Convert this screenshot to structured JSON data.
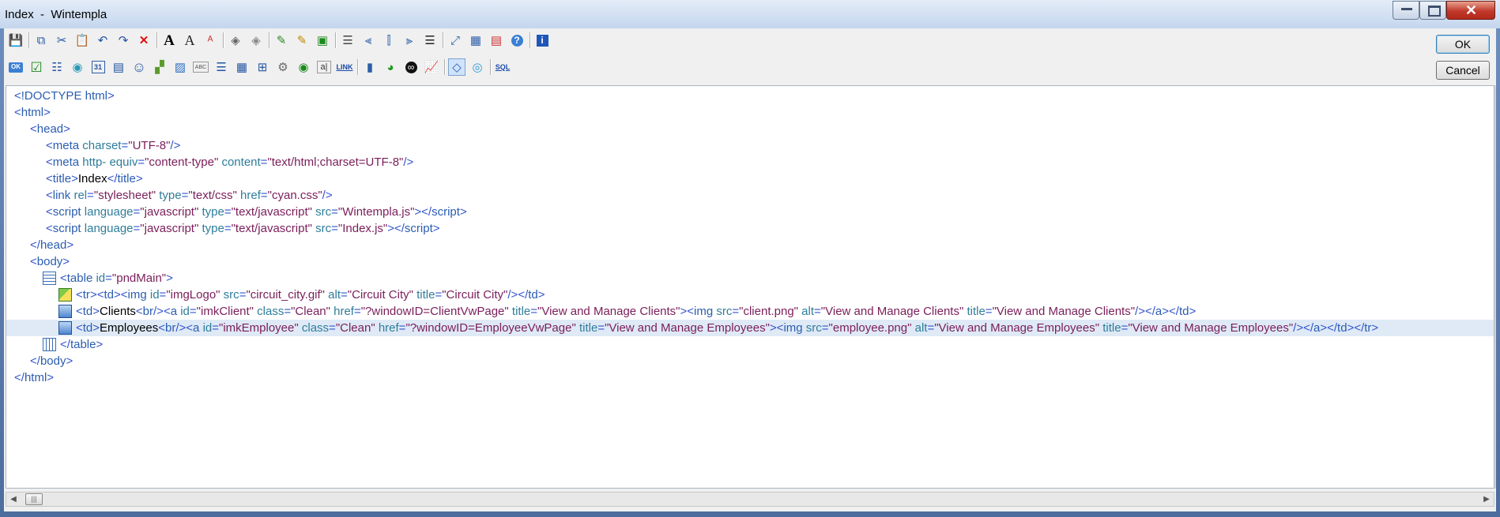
{
  "window": {
    "title": "Index  -  Wintempla",
    "minimize_label": "",
    "maximize_label": "",
    "close_label": "✕"
  },
  "dialog_buttons": {
    "ok": "OK",
    "cancel": "Cancel"
  },
  "toolbar1": {
    "icons": [
      "save-icon",
      "copy-icon",
      "cut-icon",
      "paste-icon",
      "undo-icon",
      "redo-icon",
      "delete-icon",
      "font-icon",
      "font-color-icon",
      "auto-font-icon",
      "fill-icon",
      "auto-fill-icon",
      "pencils-icon",
      "auto-pencils-icon",
      "frame-icon",
      "auto-lines-icon",
      "align-left-icon",
      "align-center-icon",
      "align-right-icon",
      "justify-icon",
      "fit-icon",
      "table-icon",
      "grid-icon",
      "help-icon",
      "info-icon"
    ]
  },
  "toolbar2": {
    "icons": [
      "ok-button-icon",
      "checkbox-icon",
      "listbox-icon",
      "radio-icon",
      "date-icon",
      "dropdown-icon",
      "smiley-icon",
      "chart-image-icon",
      "picture-icon",
      "abc-textbox-icon",
      "listview-icon",
      "grid-view-icon",
      "tree-view-icon",
      "tool-icon",
      "radio-button-icon",
      "label-icon",
      "link-icon",
      "bar-chart-icon",
      "pie-chart-icon",
      "sensor-icon",
      "line-chart-icon",
      "code-view-icon",
      "web-icon",
      "sql-icon"
    ],
    "link_text": "LINK",
    "sql_text": "SQL",
    "abc_text": "ABC"
  },
  "code_lines": [
    [
      [
        "p",
        "<"
      ],
      [
        "t",
        "!DOCTYPE html"
      ],
      [
        "p",
        ">"
      ]
    ],
    [
      [
        "p",
        "<"
      ],
      [
        "t",
        "html"
      ],
      [
        "p",
        ">"
      ]
    ],
    [
      [
        "p",
        "<"
      ],
      [
        "t",
        "head"
      ],
      [
        "p",
        ">"
      ]
    ],
    [
      [
        "p",
        "<"
      ],
      [
        "t",
        "meta "
      ],
      [
        "a",
        "charset"
      ],
      [
        "p",
        "="
      ],
      [
        "v",
        "\"UTF-8\""
      ],
      [
        "p",
        "/>"
      ]
    ],
    [
      [
        "p",
        "<"
      ],
      [
        "t",
        "meta "
      ],
      [
        "a",
        "http- equiv"
      ],
      [
        "p",
        "="
      ],
      [
        "v",
        "\"content-type\""
      ],
      [
        "a",
        " content"
      ],
      [
        "p",
        "="
      ],
      [
        "v",
        "\"text/html;charset=UTF-8\""
      ],
      [
        "p",
        "/>"
      ]
    ],
    [
      [
        "p",
        "<"
      ],
      [
        "t",
        "title"
      ],
      [
        "p",
        ">"
      ],
      [
        "x",
        "Index"
      ],
      [
        "p",
        "</"
      ],
      [
        "t",
        "title"
      ],
      [
        "p",
        ">"
      ]
    ],
    [
      [
        "p",
        "<"
      ],
      [
        "t",
        "link "
      ],
      [
        "a",
        "rel"
      ],
      [
        "p",
        "="
      ],
      [
        "v",
        "\"stylesheet\""
      ],
      [
        "a",
        " type"
      ],
      [
        "p",
        "="
      ],
      [
        "v",
        "\"text/css\""
      ],
      [
        "a",
        " href"
      ],
      [
        "p",
        "="
      ],
      [
        "v",
        "\"cyan.css\""
      ],
      [
        "p",
        "/>"
      ]
    ],
    [
      [
        "p",
        "<"
      ],
      [
        "t",
        "script "
      ],
      [
        "a",
        "language"
      ],
      [
        "p",
        "="
      ],
      [
        "v",
        "\"javascript\""
      ],
      [
        "a",
        " type"
      ],
      [
        "p",
        "="
      ],
      [
        "v",
        "\"text/javascript\""
      ],
      [
        "a",
        " src"
      ],
      [
        "p",
        "="
      ],
      [
        "v",
        "\"Wintempla.js\""
      ],
      [
        "p",
        "></"
      ],
      [
        "t",
        "script"
      ],
      [
        "p",
        ">"
      ]
    ],
    [
      [
        "p",
        "<"
      ],
      [
        "t",
        "script "
      ],
      [
        "a",
        "language"
      ],
      [
        "p",
        "="
      ],
      [
        "v",
        "\"javascript\""
      ],
      [
        "a",
        " type"
      ],
      [
        "p",
        "="
      ],
      [
        "v",
        "\"text/javascript\""
      ],
      [
        "a",
        " src"
      ],
      [
        "p",
        "="
      ],
      [
        "v",
        "\"Index.js\""
      ],
      [
        "p",
        "></"
      ],
      [
        "t",
        "script"
      ],
      [
        "p",
        ">"
      ]
    ],
    [
      [
        "p",
        "</"
      ],
      [
        "t",
        "head"
      ],
      [
        "p",
        ">"
      ]
    ],
    [
      [
        "p",
        "<"
      ],
      [
        "t",
        "body"
      ],
      [
        "p",
        ">"
      ]
    ],
    [
      [
        "p",
        "<"
      ],
      [
        "t",
        "table "
      ],
      [
        "a",
        "id"
      ],
      [
        "p",
        "="
      ],
      [
        "v",
        "\"pndMain\""
      ],
      [
        "p",
        ">"
      ]
    ],
    [
      [
        "p",
        "<"
      ],
      [
        "t",
        "tr"
      ],
      [
        "p",
        "><"
      ],
      [
        "t",
        "td"
      ],
      [
        "p",
        "><"
      ],
      [
        "t",
        "img "
      ],
      [
        "a",
        "id"
      ],
      [
        "p",
        "="
      ],
      [
        "v",
        "\"imgLogo\""
      ],
      [
        "a",
        " src"
      ],
      [
        "p",
        "="
      ],
      [
        "v",
        "\"circuit_city.gif\""
      ],
      [
        "a",
        " alt"
      ],
      [
        "p",
        "="
      ],
      [
        "v",
        "\"Circuit City\""
      ],
      [
        "a",
        " title"
      ],
      [
        "p",
        "="
      ],
      [
        "v",
        "\"Circuit City\""
      ],
      [
        "p",
        "/></"
      ],
      [
        "t",
        "td"
      ],
      [
        "p",
        ">"
      ]
    ],
    [
      [
        "p",
        "<"
      ],
      [
        "t",
        "td"
      ],
      [
        "p",
        ">"
      ],
      [
        "x",
        "Clients"
      ],
      [
        "p",
        "<"
      ],
      [
        "t",
        "br"
      ],
      [
        "p",
        "/><"
      ],
      [
        "t",
        "a "
      ],
      [
        "a",
        "id"
      ],
      [
        "p",
        "="
      ],
      [
        "v",
        "\"imkClient\""
      ],
      [
        "a",
        " class"
      ],
      [
        "p",
        "="
      ],
      [
        "v",
        "\"Clean\""
      ],
      [
        "a",
        " href"
      ],
      [
        "p",
        "="
      ],
      [
        "v",
        "\"?windowID=ClientVwPage\""
      ],
      [
        "a",
        " title"
      ],
      [
        "p",
        "="
      ],
      [
        "v",
        "\"View and Manage Clients\""
      ],
      [
        "p",
        "><"
      ],
      [
        "t",
        "img "
      ],
      [
        "a",
        "src"
      ],
      [
        "p",
        "="
      ],
      [
        "v",
        "\"client.png\""
      ],
      [
        "a",
        " alt"
      ],
      [
        "p",
        "="
      ],
      [
        "v",
        "\"View and Manage Clients\""
      ],
      [
        "a",
        " title"
      ],
      [
        "p",
        "="
      ],
      [
        "v",
        "\"View and Manage Clients\""
      ],
      [
        "p",
        "/></"
      ],
      [
        "t",
        "a"
      ],
      [
        "p",
        "></"
      ],
      [
        "t",
        "td"
      ],
      [
        "p",
        ">"
      ]
    ],
    [
      [
        "p",
        "<"
      ],
      [
        "t",
        "td"
      ],
      [
        "p",
        ">"
      ],
      [
        "x",
        "Employees"
      ],
      [
        "p",
        "<"
      ],
      [
        "t",
        "br"
      ],
      [
        "p",
        "/><"
      ],
      [
        "t",
        "a "
      ],
      [
        "a",
        "id"
      ],
      [
        "p",
        "="
      ],
      [
        "v",
        "\"imkEmployee\""
      ],
      [
        "a",
        " class"
      ],
      [
        "p",
        "="
      ],
      [
        "v",
        "\"Clean\""
      ],
      [
        "a",
        " href"
      ],
      [
        "p",
        "="
      ],
      [
        "v",
        "\"?windowID=EmployeeVwPage\""
      ],
      [
        "a",
        " title"
      ],
      [
        "p",
        "="
      ],
      [
        "v",
        "\"View and Manage Employees\""
      ],
      [
        "p",
        "><"
      ],
      [
        "t",
        "img "
      ],
      [
        "a",
        "src"
      ],
      [
        "p",
        "="
      ],
      [
        "v",
        "\"employee.png\""
      ],
      [
        "a",
        " alt"
      ],
      [
        "p",
        "="
      ],
      [
        "v",
        "\"View and Manage Employees\""
      ],
      [
        "a",
        " title"
      ],
      [
        "p",
        "="
      ],
      [
        "v",
        "\"View and Manage Employees\""
      ],
      [
        "p",
        "/></"
      ],
      [
        "t",
        "a"
      ],
      [
        "p",
        "></"
      ],
      [
        "t",
        "td"
      ],
      [
        "p",
        "></"
      ],
      [
        "t",
        "tr"
      ],
      [
        "p",
        ">"
      ]
    ],
    [
      [
        "p",
        "</"
      ],
      [
        "t",
        "table"
      ],
      [
        "p",
        ">"
      ]
    ],
    [
      [
        "p",
        "</"
      ],
      [
        "t",
        "body"
      ],
      [
        "p",
        ">"
      ]
    ],
    [
      [
        "p",
        "</"
      ],
      [
        "t",
        "html"
      ],
      [
        "p",
        ">"
      ]
    ]
  ]
}
